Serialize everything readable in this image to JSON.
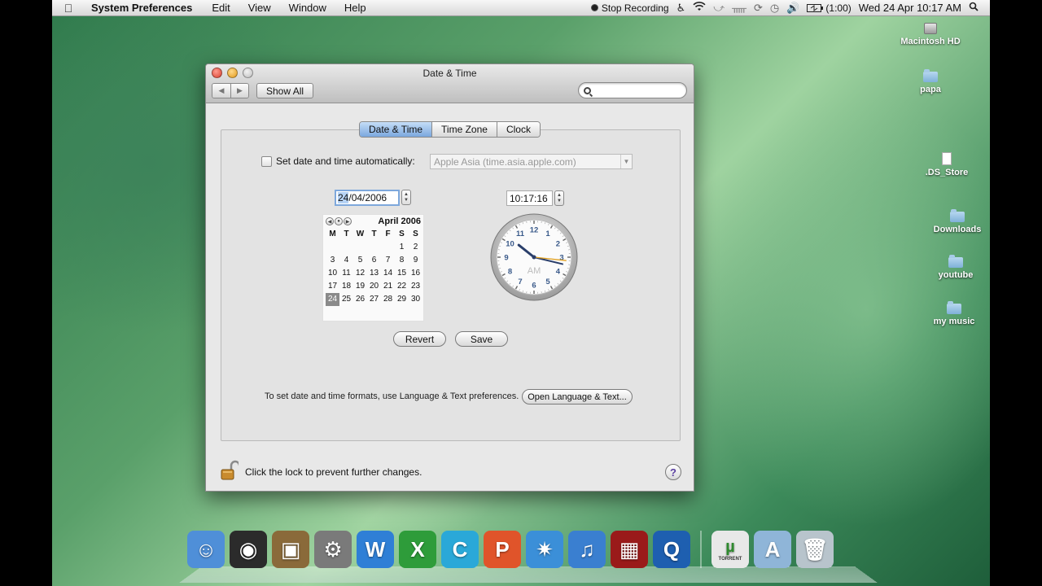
{
  "menubar": {
    "app_name": "System Preferences",
    "menus": [
      "Edit",
      "View",
      "Window",
      "Help"
    ],
    "stop_recording": "Stop Recording",
    "battery": "(1:00)",
    "datetime": "Wed 24 Apr  10:17 AM"
  },
  "desktop": {
    "icons": [
      {
        "label": "Macintosh HD",
        "icon": "hard-drive-icon"
      },
      {
        "label": "papa",
        "icon": "folder-icon"
      },
      {
        "label": ".DS_Store",
        "icon": "document-icon"
      },
      {
        "label": "Downloads",
        "icon": "folder-icon"
      },
      {
        "label": "youtube",
        "icon": "folder-icon"
      },
      {
        "label": "my music",
        "icon": "folder-icon"
      }
    ]
  },
  "window": {
    "title": "Date & Time",
    "show_all": "Show All",
    "search_placeholder": "",
    "tabs": [
      {
        "label": "Date & Time",
        "active": true
      },
      {
        "label": "Time Zone",
        "active": false
      },
      {
        "label": "Clock",
        "active": false
      }
    ],
    "auto_label": "Set date and time automatically:",
    "auto_checked": false,
    "server": "Apple Asia (time.asia.apple.com)",
    "date_day": "24",
    "date_rest": "/04/2006",
    "time": "10:17:16",
    "calendar": {
      "month": "April 2006",
      "weekdays": [
        "M",
        "T",
        "W",
        "T",
        "F",
        "S",
        "S"
      ],
      "weeks": [
        [
          "",
          "",
          "",
          "",
          "",
          "1",
          "2"
        ],
        [
          "3",
          "4",
          "5",
          "6",
          "7",
          "8",
          "9"
        ],
        [
          "10",
          "11",
          "12",
          "13",
          "14",
          "15",
          "16"
        ],
        [
          "17",
          "18",
          "19",
          "20",
          "21",
          "22",
          "23"
        ],
        [
          "24",
          "25",
          "26",
          "27",
          "28",
          "29",
          "30"
        ]
      ],
      "selected_day": "24"
    },
    "clock": {
      "numbers": [
        "12",
        "1",
        "2",
        "3",
        "4",
        "5",
        "6",
        "7",
        "8",
        "9",
        "10",
        "11"
      ],
      "ampm": "AM",
      "hour": 10,
      "minute": 17,
      "second": 16
    },
    "revert": "Revert",
    "save": "Save",
    "formats_text": "To set date and time formats, use Language & Text preferences.",
    "open_lang": "Open Language & Text...",
    "lock_text": "Click the lock to prevent further changes.",
    "help": "?"
  },
  "dock": {
    "items": [
      {
        "name": "finder",
        "glyph": "☺",
        "color": "#4f8fd8"
      },
      {
        "name": "dashboard",
        "glyph": "◉",
        "color": "#2b2b2b"
      },
      {
        "name": "iphoto",
        "glyph": "▣",
        "color": "#8a6a3a"
      },
      {
        "name": "system-preferences",
        "glyph": "⚙",
        "color": "#7a7a7a"
      },
      {
        "name": "word",
        "glyph": "W",
        "color": "#2f7fd6"
      },
      {
        "name": "excel",
        "glyph": "X",
        "color": "#2e9c3a"
      },
      {
        "name": "c-app",
        "glyph": "C",
        "color": "#2aa8d8"
      },
      {
        "name": "powerpoint",
        "glyph": "P",
        "color": "#e0542a"
      },
      {
        "name": "safari",
        "glyph": "✷",
        "color": "#3b8fd8"
      },
      {
        "name": "itunes",
        "glyph": "♫",
        "color": "#3a7fd0"
      },
      {
        "name": "photo-booth",
        "glyph": "▦",
        "color": "#9a1a1a"
      },
      {
        "name": "quicktime",
        "glyph": "Q",
        "color": "#1e5fb0"
      },
      {
        "name": "utorrent",
        "glyph": "µ",
        "color": "#e8e8e8"
      },
      {
        "name": "applications-folder",
        "glyph": "A",
        "color": "#8fb5d8"
      },
      {
        "name": "trash",
        "glyph": "🗑",
        "color": "#b8c4cc"
      }
    ],
    "utorrent_label": "TORRENT"
  }
}
